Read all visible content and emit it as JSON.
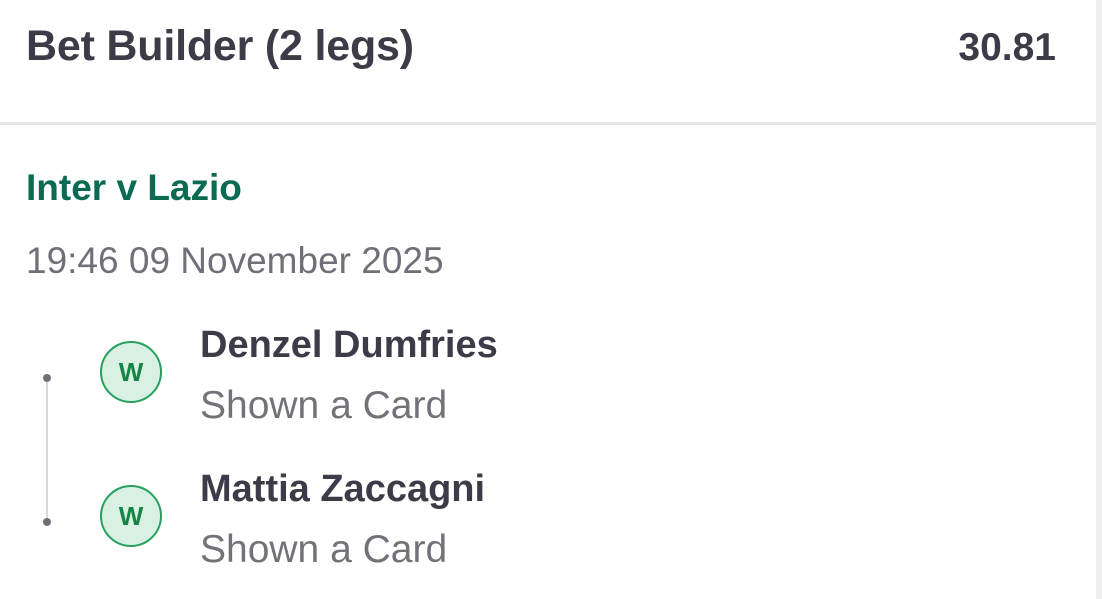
{
  "bet": {
    "title": "Bet Builder (2 legs)",
    "odds": "30.81"
  },
  "match": {
    "name": "Inter v Lazio",
    "datetime": "19:46 09 November 2025"
  },
  "legs": [
    {
      "status": "W",
      "status_meaning": "won",
      "player": "Denzel Dumfries",
      "market": "Shown a Card"
    },
    {
      "status": "W",
      "status_meaning": "won",
      "player": "Mattia Zaccagni",
      "market": "Shown a Card"
    }
  ],
  "colors": {
    "title_text": "#3c3c48",
    "match_name": "#0b6b52",
    "muted_text": "#727279",
    "win_badge_border": "#26a05c",
    "win_badge_fill": "#d9f1e2",
    "win_badge_text": "#168448"
  }
}
